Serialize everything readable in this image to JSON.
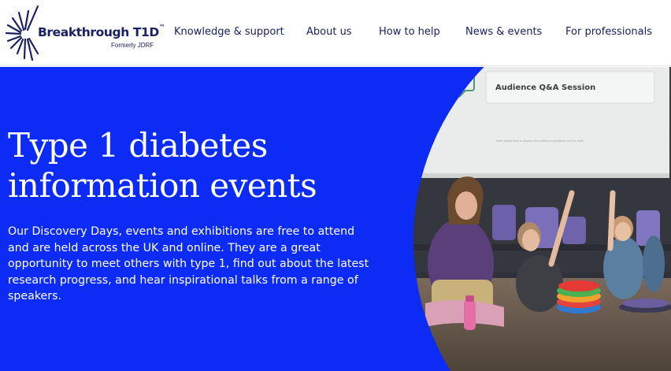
{
  "brand": {
    "name": "Breakthrough T1D",
    "trademark": "™",
    "subtitle": "Formerly JDRF",
    "navy": "#1a2161"
  },
  "nav": {
    "items": [
      {
        "label": "Knowledge & support"
      },
      {
        "label": "About us"
      },
      {
        "label": "How to help"
      },
      {
        "label": "News & events"
      },
      {
        "label": "For professionals"
      }
    ]
  },
  "hero": {
    "title": "Type 1 diabetes information events",
    "description": "Our Discovery Days, events and exhibitions are free to attend and are held across the UK and online. They are a great opportunity to meet others with type 1, find out about the latest research progress, and hear inspirational talks from a range of speakers.",
    "background_color": "#0c2cf5",
    "image": {
      "screen_text": "Audience Q&A Session",
      "screen_footnote": "Start presenting to display the audience questions on this slide"
    }
  }
}
